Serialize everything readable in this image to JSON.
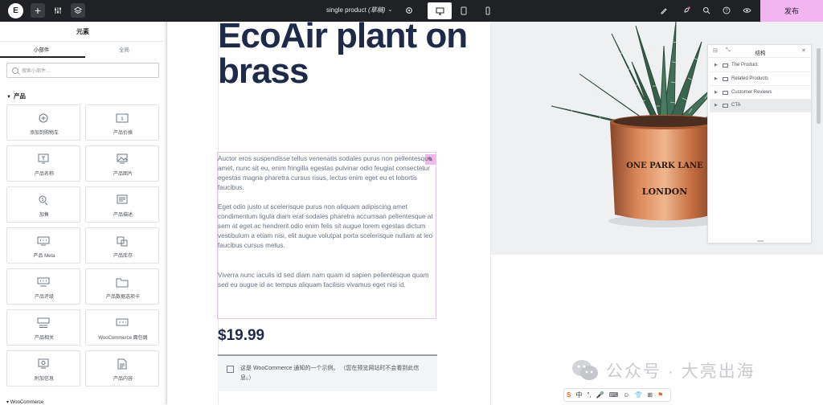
{
  "topbar": {
    "logo": "E",
    "plus": "+",
    "document_title": "single product",
    "document_status": "(草稿)",
    "publish_label": "发布"
  },
  "panel": {
    "title": "元素",
    "tabs": [
      "小部件",
      "全局"
    ],
    "search_placeholder": "搜索小部件...",
    "category_title": "产品",
    "widgets": [
      {
        "label": "添加到购物车",
        "icon": "cart-plus-icon"
      },
      {
        "label": "产品价格",
        "icon": "price-icon"
      },
      {
        "label": "产品名称",
        "icon": "product-title-icon"
      },
      {
        "label": "产品图片",
        "icon": "product-image-icon"
      },
      {
        "label": "加售",
        "icon": "upsell-icon"
      },
      {
        "label": "产品描述",
        "icon": "description-icon"
      },
      {
        "label": "产品 Meta",
        "icon": "meta-icon"
      },
      {
        "label": "产品库存",
        "icon": "stock-icon"
      },
      {
        "label": "产品评级",
        "icon": "rating-icon"
      },
      {
        "label": "产品数据选项卡",
        "icon": "data-tabs-icon"
      },
      {
        "label": "产品相关",
        "icon": "related-icon"
      },
      {
        "label": "WooCommerce 面包屑",
        "icon": "breadcrumbs-icon"
      },
      {
        "label": "附加信息",
        "icon": "additional-info-icon"
      },
      {
        "label": "产品内容",
        "icon": "product-content-icon"
      }
    ],
    "next_category": "WooCommerce"
  },
  "page": {
    "title": "EcoAir plant on brass",
    "description": [
      "Auctor eros suspendisse tellus venenatis sodales purus non pellentesque amet, nunc sit eu, enim fringilla egestas pulvinar odio feugiat consectetur egestas magna pharetra cursus risus, lectus enim eget eu et lobortis faucibus.",
      "Eget odio justo ut scelerisque purus non aliquam adipiscing amet condimentum ligula diam erat sodales pharetra accumsan pellentesque at sem at eget ac hendrerit odio enim felis sit augue lorem egestas dictum vestibulum a etiam nisi, elit augue volutpat porta scelerisque nullam at leo faucibus cursus metus.",
      "Viverra nunc iaculis id sed diam nam quam id sapien pellentesque quam sed eu augue id ac tempus aliquam facilisis vivamus eget nisi id."
    ],
    "price": "$19.99",
    "notice": "这是 WooCommerce 通知的一个示例。 （您在预览网站时不会看到此信息。）",
    "pot_text_top": "ONE PARK LANE",
    "pot_text_bottom": "LONDON"
  },
  "navigator": {
    "title": "结构",
    "items": [
      "The Product",
      "Related Products",
      "Customer Reviews",
      "CTA"
    ],
    "selected_index": 3
  },
  "watermark": "公众号 · 大亮出海",
  "ime": {
    "logo": "S",
    "chars": [
      "中",
      "°,",
      "🎤",
      "⌨",
      "☺",
      "👕",
      "⊞"
    ]
  },
  "colors": {
    "topbar_bg": "#1f2124",
    "publish_bg": "#f1b6f0",
    "heading": "#1f2a4b",
    "accent_pink": "#efb8ee",
    "copper": "#c9744b"
  }
}
